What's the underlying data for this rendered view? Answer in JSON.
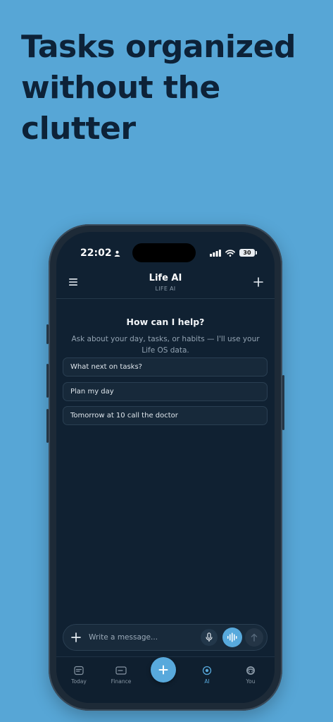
{
  "headline": {
    "line1": "Tasks organized",
    "line2": "without the",
    "line3": "clutter"
  },
  "status_bar": {
    "time": "22:02",
    "battery": "30"
  },
  "app_bar": {
    "title": "Life AI",
    "subtitle": "LIFE AI"
  },
  "main": {
    "help_title": "How can I help?",
    "help_description": "Ask about your day, tasks, or habits — I'll use your Life OS data.",
    "suggestions": [
      "What next on tasks?",
      "Plan my day",
      "Tomorrow at 10 call the doctor"
    ]
  },
  "composer": {
    "placeholder": "Write a message...",
    "value": ""
  },
  "tabbar": {
    "items": [
      {
        "label": "Today",
        "icon": "calendar-icon"
      },
      {
        "label": "Finance",
        "icon": "card-icon"
      },
      {
        "label": "AI",
        "icon": "ai-icon"
      },
      {
        "label": "You",
        "icon": "avatar-icon"
      }
    ],
    "active": "AI"
  },
  "colors": {
    "background": "#57a6d6",
    "headline": "#0d2238",
    "screen": "#102132",
    "accent": "#58a9dc"
  }
}
